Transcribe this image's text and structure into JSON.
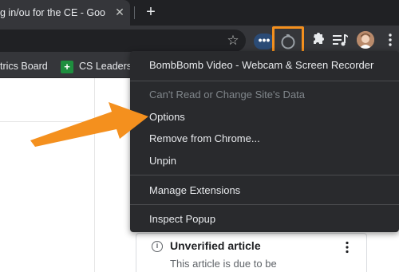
{
  "tab": {
    "title": "g in/ou for the CE - Goo",
    "close_icon": "close-icon"
  },
  "toolbar": {
    "more_dots": "•••",
    "icons": [
      "star-icon",
      "bombbomb-icon",
      "puzzle-icon",
      "media-control-icon",
      "avatar",
      "kebab-icon"
    ]
  },
  "bookmarks": [
    {
      "label": "trics Board"
    },
    {
      "label": "CS Leaders",
      "icon_text": "+"
    }
  ],
  "menu": {
    "title": "BombBomb Video - Webcam & Screen Recorder",
    "items": [
      {
        "label": "Can't Read or Change Site's Data",
        "enabled": false
      },
      {
        "label": "Options",
        "enabled": true
      },
      {
        "label": "Remove from Chrome...",
        "enabled": true
      },
      {
        "label": "Unpin",
        "enabled": true
      },
      {
        "label": "Manage Extensions",
        "enabled": true
      },
      {
        "label": "Inspect Popup",
        "enabled": true
      }
    ]
  },
  "card": {
    "title": "Unverified article",
    "text": "This article is due to be"
  },
  "colors": {
    "highlight": "#f4901e",
    "arrow": "#f4901e",
    "menu_bg": "#292a2d",
    "toolbar_bg": "#35363a"
  }
}
